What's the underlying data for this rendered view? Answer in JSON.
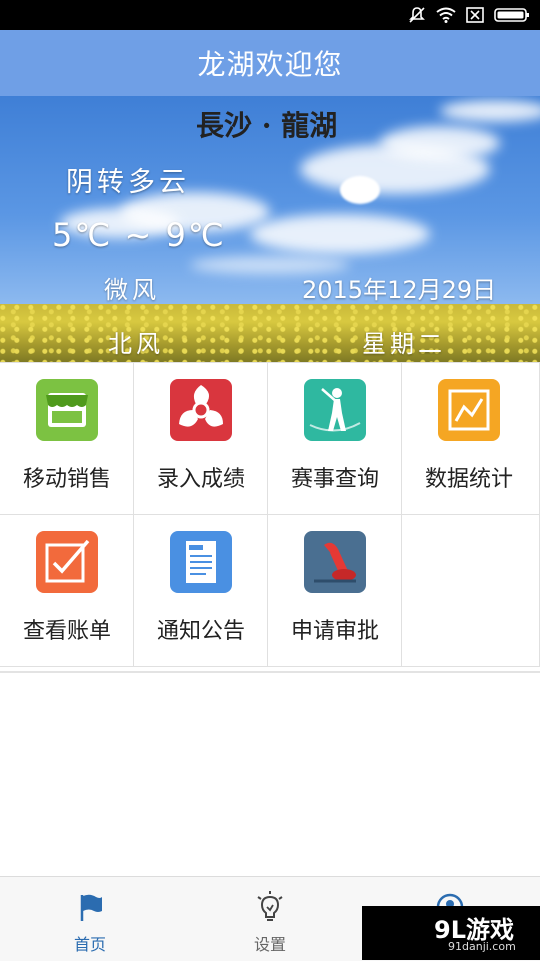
{
  "app": {
    "title": "龙湖欢迎您"
  },
  "banner": {
    "city": "長沙 · 龍湖",
    "weather": "阴转多云",
    "temperature": "5℃ ~ 9℃",
    "wind_level": "微风",
    "date": "2015年12月29日",
    "wind_direction": "北风",
    "weekday": "星期二"
  },
  "menu": {
    "items": [
      {
        "label": "移动销售",
        "icon": "store-icon",
        "color": "#7cc242"
      },
      {
        "label": "录入成绩",
        "icon": "propeller-icon",
        "color": "#d9363e"
      },
      {
        "label": "赛事查询",
        "icon": "golfer-icon",
        "color": "#2fb8a0"
      },
      {
        "label": "数据统计",
        "icon": "chart-icon",
        "color": "#f5a623"
      },
      {
        "label": "查看账单",
        "icon": "checkbox-icon",
        "color": "#f26a3c"
      },
      {
        "label": "通知公告",
        "icon": "news-icon",
        "color": "#4a90e2"
      },
      {
        "label": "申请审批",
        "icon": "stamp-icon",
        "color": "#4a6f91"
      }
    ]
  },
  "tabs": [
    {
      "label": "首页",
      "icon": "flag-icon",
      "active": true
    },
    {
      "label": "设置",
      "icon": "lightbulb-icon",
      "active": false
    },
    {
      "label": "",
      "icon": "user-icon",
      "active": false
    }
  ],
  "watermark": {
    "main": "9L游戏",
    "sub": "91danji.com"
  }
}
